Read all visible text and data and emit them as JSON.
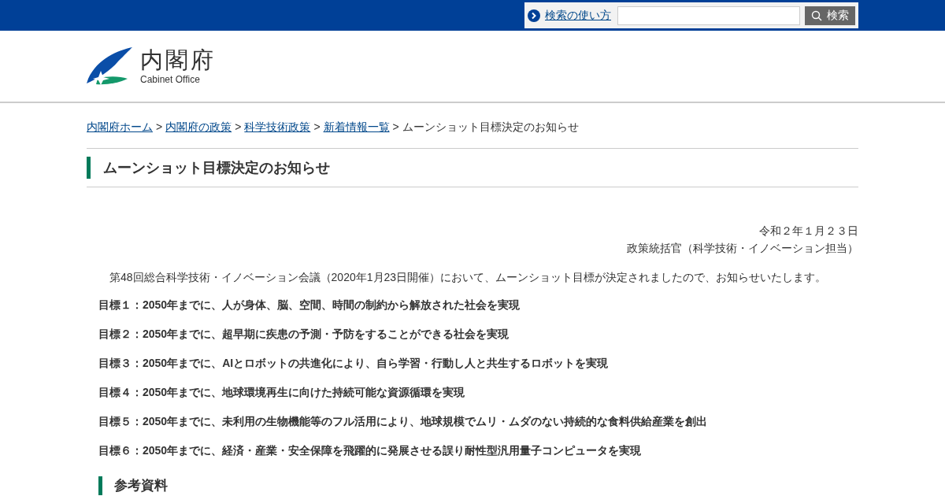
{
  "top_bar": {
    "help_link": "検索の使い方",
    "search_button": "検索"
  },
  "header": {
    "logo_title": "内閣府",
    "logo_subtitle": "Cabinet Office"
  },
  "breadcrumb": [
    {
      "label": "内閣府ホーム",
      "link": true
    },
    {
      "separator": ">",
      "label": "内閣府の政策",
      "link": true
    },
    {
      "separator": ">",
      "label": "科学技術政策",
      "link": true
    },
    {
      "separator": ">",
      "label": "新着情報一覧",
      "link": true
    },
    {
      "separator": ">",
      "label": "ムーンショット目標決定のお知らせ",
      "link": false
    }
  ],
  "page_title": "ムーンショット目標決定のお知らせ",
  "date": "令和２年１月２３日",
  "author": "政策統括官（科学技術・イノベーション担当）",
  "intro": "第48回総合科学技術・イノベーション会議（2020年1月23日開催）において、ムーンショット目標が決定されましたので、お知らせいたします。",
  "goals": [
    "目標１：2050年までに、人が身体、脳、空間、時間の制約から解放された社会を実現",
    "目標２：2050年までに、超早期に疾患の予測・予防をすることができる社会を実現",
    "目標３：2050年までに、AIとロボットの共進化により、自ら学習・行動し人と共生するロボットを実現",
    "目標４：2050年までに、地球環境再生に向けた持続可能な資源循環を実現",
    "目標５：2050年までに、未利用の生物機能等のフル活用により、地球規模でムリ・ムダのない持続的な食料供給産業を創出",
    "目標６：2050年までに、経済・産業・安全保障を飛躍的に発展させる誤り耐性型汎用量子コンピュータを実現"
  ],
  "section_heading": "参考資料"
}
